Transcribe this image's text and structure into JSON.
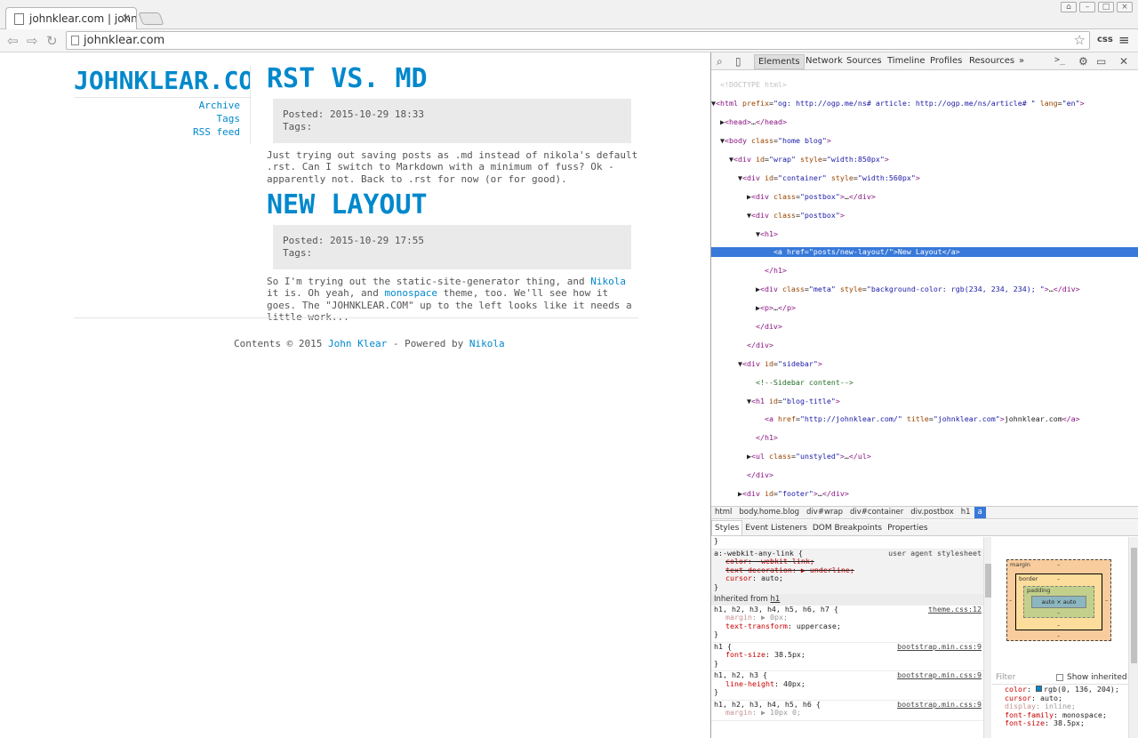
{
  "browser": {
    "tab_title": "johnklear.com | johnklear.com",
    "tab_close": "×",
    "url": "johnklear.com",
    "css_button": "css",
    "menu": "≡",
    "window_buttons": [
      "⌂",
      "–",
      "□",
      "×"
    ]
  },
  "site": {
    "blog_title": "JOHNKLEAR.COM",
    "sidebar_links": [
      "Archive",
      "Tags",
      "RSS feed"
    ],
    "posts": [
      {
        "title": "RST VS. MD",
        "posted": "Posted: 2015-10-29 18:33",
        "tags": "Tags:",
        "body": "Just trying out saving posts as .md instead of nikola's default .rst. Can I switch to Markdown with a minimum of fuss? Ok - apparently not. Back to .rst for now (or for good)."
      },
      {
        "title": "NEW LAYOUT",
        "posted": "Posted: 2015-10-29 17:55",
        "tags": "Tags:",
        "body_pre": "So I'm trying out the static-site-generator thing, and ",
        "link_nikola": "Nikola",
        "body_mid": " it is. Oh yeah, and ",
        "link_monospace": "monospace",
        "body_post": " theme, too. We'll see how it goes. The \"JOHNKLEAR.COM\" up to the left looks like it needs a little work..."
      }
    ],
    "footer": {
      "pre": "Contents © 2015 ",
      "author": "John Klear",
      "mid": " - Powered by ",
      "engine": "Nikola"
    }
  },
  "devtools": {
    "tabs": [
      "Elements",
      "Network",
      "Sources",
      "Timeline",
      "Profiles",
      "Resources",
      "»"
    ],
    "icons": {
      "search": "search-icon",
      "device": "device-icon",
      "console": "console-icon",
      "settings": "gear-icon",
      "dock": "dock-icon",
      "close": "close-icon"
    },
    "breadcrumbs": [
      "html",
      "body.home.blog",
      "div#wrap",
      "div#container",
      "div.postbox",
      "h1",
      "a"
    ],
    "sub_tabs": [
      "Styles",
      "Event Listeners",
      "DOM Breakpoints",
      "Properties"
    ],
    "styles": {
      "brace": "}",
      "rule1_selector": "a:-webkit-any-link {",
      "rule1_source": "user agent stylesheet",
      "rule1_p1": "color: -webkit-link;",
      "rule1_p2": "text-decoration: ▶ underline;",
      "rule1_p3n": "cursor",
      "rule1_p3v": ": auto;",
      "inherited_label": "Inherited from ",
      "inherited_from": "h1",
      "rule2_selector": "h1, h2, h3, h4, h5, h6, h7 {",
      "rule2_source": "theme.css:12",
      "rule2_p1n": "margin",
      "rule2_p1v": ": ▶ 0px;",
      "rule2_p2n": "text-transform",
      "rule2_p2v": ": uppercase;",
      "rule3_selector": "h1 {",
      "rule3_source": "bootstrap.min.css:9",
      "rule3_p1n": "font-size",
      "rule3_p1v": ": 38.5px;",
      "rule4_selector": "h1, h2, h3 {",
      "rule4_source": "bootstrap.min.css:9",
      "rule4_p1n": "line-height",
      "rule4_p1v": ": 40px;",
      "rule5_selector": "h1, h2, h3, h4, h5, h6 {",
      "rule5_source": "bootstrap.min.css:9",
      "rule5_p1n": "margin",
      "rule5_p1v": ": ▶ 10px 0;"
    },
    "box_model": {
      "margin": "margin",
      "border": "border",
      "padding": "padding",
      "content": "auto × auto",
      "dash": "–"
    },
    "filter": {
      "placeholder": "Filter",
      "show_inherited": "Show inherited"
    },
    "computed": [
      {
        "name": "color",
        "value": ": rgb(0, 136, 204);",
        "swatch": "#0088cc"
      },
      {
        "name": "cursor",
        "value": ": auto;"
      },
      {
        "name": "display",
        "value": ": inline;",
        "dim": true
      },
      {
        "name": "font-family",
        "value": ": monospace;"
      },
      {
        "name": "font-size",
        "value": ": 38.5px;"
      }
    ]
  }
}
